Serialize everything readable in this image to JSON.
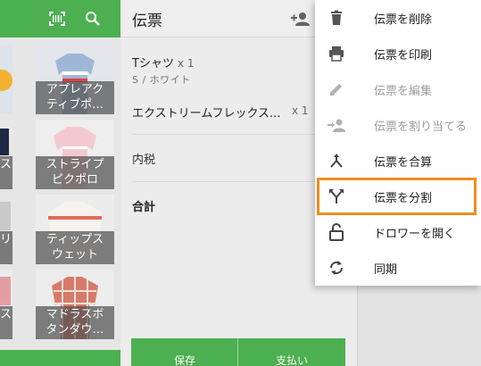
{
  "left_panel": {
    "tiles": [
      {
        "caption": [
          "アプレアク",
          "ティブポ…"
        ]
      },
      {
        "caption": [
          "ストライプ",
          "ピクポロ"
        ]
      },
      {
        "caption": [
          "ティップス",
          "ウェット"
        ]
      },
      {
        "caption": [
          "マドラスボ",
          "タンダウ…"
        ]
      },
      {
        "caption": [
          "ス"
        ]
      },
      {
        "caption": [
          "リ"
        ]
      },
      {
        "caption": [
          "ス"
        ]
      }
    ]
  },
  "ticket": {
    "title": "伝票",
    "items": [
      {
        "name": "Tシャツ",
        "qty": "x 1",
        "variant": "S / ホワイト"
      },
      {
        "name": "エクストリームフレックス...",
        "qty": "x 1"
      }
    ],
    "tax_label": "内税",
    "total_label": "合計",
    "save_label": "保存",
    "pay_label": "支払い"
  },
  "menu": {
    "items": [
      {
        "label": "伝票を削除",
        "icon": "trash-icon",
        "enabled": true
      },
      {
        "label": "伝票を印刷",
        "icon": "printer-icon",
        "enabled": true
      },
      {
        "label": "伝票を編集",
        "icon": "pencil-icon",
        "enabled": false
      },
      {
        "label": "伝票を割り当てる",
        "icon": "assign-person-icon",
        "enabled": false
      },
      {
        "label": "伝票を合算",
        "icon": "merge-icon",
        "enabled": true
      },
      {
        "label": "伝票を分割",
        "icon": "split-icon",
        "enabled": true,
        "highlighted": true
      },
      {
        "label": "ドロワーを開く",
        "icon": "unlock-icon",
        "enabled": true
      },
      {
        "label": "同期",
        "icon": "sync-icon",
        "enabled": true
      }
    ]
  },
  "colors": {
    "brand_green": "#4caf50",
    "highlight_orange": "#f08c1e"
  }
}
